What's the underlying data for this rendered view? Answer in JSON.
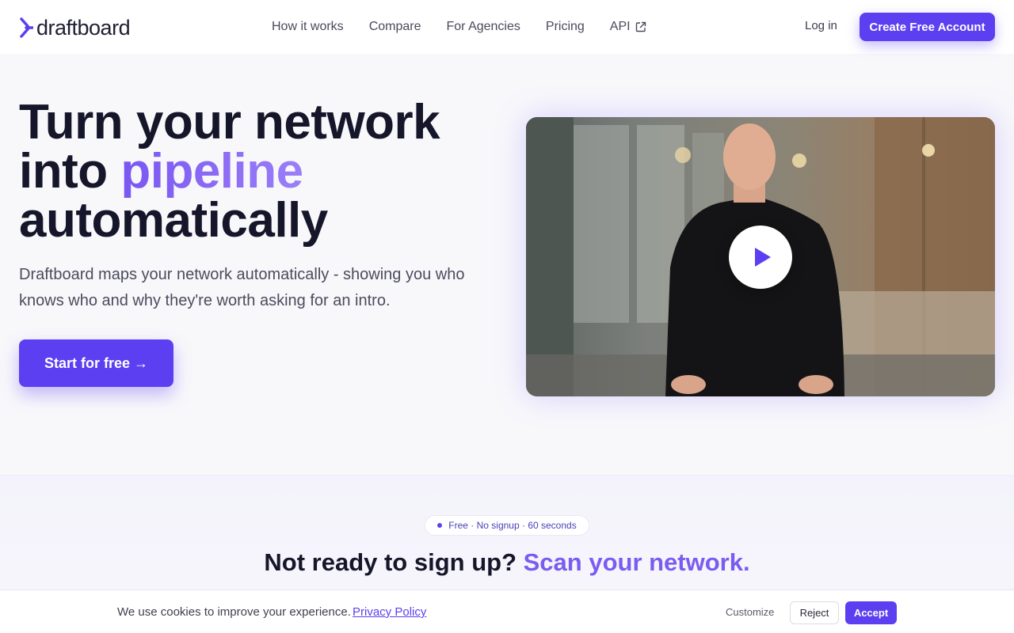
{
  "header": {
    "logo_text": "draftboard",
    "nav": [
      {
        "label": "How it works"
      },
      {
        "label": "Compare"
      },
      {
        "label": "For Agencies"
      },
      {
        "label": "Pricing"
      },
      {
        "label": "API",
        "icon": "external-link-icon"
      }
    ],
    "login_label": "Log in",
    "cta_label": "Create Free Account"
  },
  "hero": {
    "title_line1": "Turn your network",
    "title_line2_prefix": "into ",
    "title_line2_accent": "pipeline",
    "title_line3": "automatically",
    "subtitle": "Draftboard maps your network automatically - showing you who knows who and why they're worth asking for an intro.",
    "cta_label": "Start for free →"
  },
  "video": {
    "play_icon": "play-icon"
  },
  "scan": {
    "pill_text": "Free · No signup · 60 seconds",
    "title_prefix": "Not ready to sign up? ",
    "title_accent": "Scan your network."
  },
  "cookie": {
    "text": "We use cookies to improve your experience.",
    "link_label": "Privacy Policy",
    "customize_label": "Customize",
    "reject_label": "Reject",
    "accept_label": "Accept"
  },
  "colors": {
    "brand": "#5b3ff0",
    "accent_gradient_start": "#7a56f2",
    "heading": "#16162a"
  }
}
